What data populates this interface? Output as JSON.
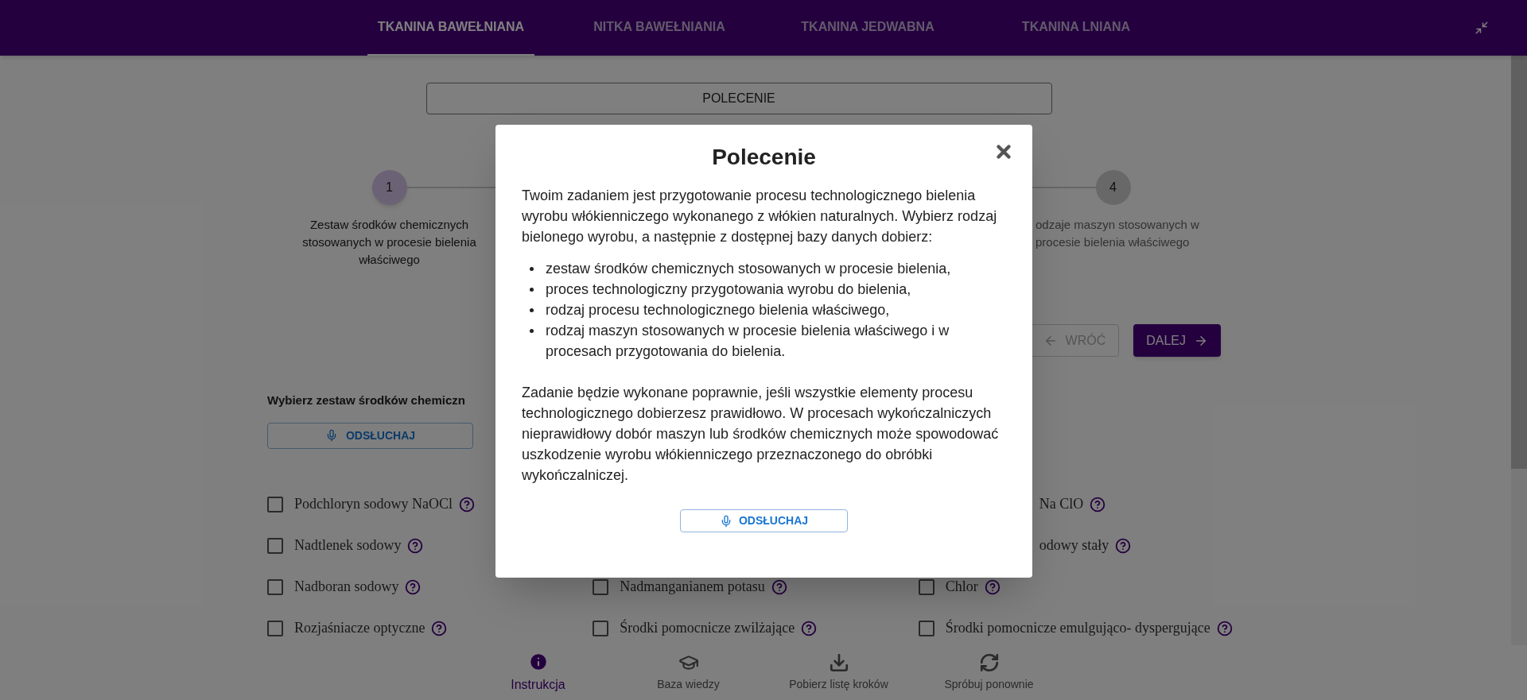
{
  "tabs": [
    {
      "label": "TKANINA BAWEŁNIANA",
      "selected": true
    },
    {
      "label": "NITKA BAWEŁNIANIA",
      "selected": false
    },
    {
      "label": "TKANINA JEDWABNA",
      "selected": false
    },
    {
      "label": "TKANINA LNIANA",
      "selected": false
    }
  ],
  "command_button": "POLECENIE",
  "steps": [
    {
      "number": "1",
      "label": "Zestaw środków chemicznych stosowanych w procesie bielenia właściwego",
      "active": true
    },
    {
      "number": "4",
      "label": "odzaje maszyn stosowanych w procesie bielenia właściwego",
      "active": false
    }
  ],
  "nav_buttons": [
    {
      "label": "WRÓĆ",
      "disabled": true,
      "kind": "back"
    },
    {
      "label": "DALEJ",
      "disabled": false,
      "kind": "next"
    }
  ],
  "section": {
    "heading": "Wybierz zestaw środków chemiczn",
    "listen_button": "ODSŁUCHAJ"
  },
  "option_rows": [
    {
      "col_1": {
        "label": "Podchloryn sodowy NaOCl",
        "checked": false,
        "kind": "checkbox"
      },
      "col_3": {
        "label": "Na ClO",
        "kind": "clipped"
      }
    },
    {
      "col_1": {
        "label": "Nadtlenek sodowy",
        "checked": false,
        "kind": "checkbox"
      },
      "col_3": {
        "label": "odowy stały",
        "kind": "clipped"
      }
    },
    {
      "col_1": {
        "label": "Nadboran sodowy",
        "checked": false,
        "kind": "checkbox"
      },
      "col_2": {
        "label": "Nadmanganianem potasu",
        "checked": false,
        "kind": "checkbox"
      },
      "col_3": {
        "label": "Chlor",
        "checked": false,
        "kind": "checkbox"
      }
    },
    {
      "col_1": {
        "label": "Rozjaśniacze optyczne",
        "checked": false,
        "kind": "checkbox"
      },
      "col_2": {
        "label": "Środki pomocnicze zwilżające",
        "checked": false,
        "kind": "checkbox"
      },
      "col_3": {
        "label": "Środki pomocnicze emulgująco- dyspergujące",
        "checked": false,
        "kind": "checkbox"
      }
    }
  ],
  "modal": {
    "title": "Polecenie",
    "intro": "Twoim zadaniem jest przygotowanie procesu technologicznego bielenia wyrobu włókienniczego wykonanego z włókien naturalnych. Wybierz rodzaj bielonego wyrobu, a następnie z dostępnej bazy danych dobierz:",
    "bullets": [
      "zestaw środków chemicznych stosowanych w procesie bielenia,",
      "proces technologiczny przygotowania wyrobu do bielenia,",
      "rodzaj procesu technologicznego bielenia właściwego,",
      "rodzaj maszyn stosowanych w procesie bielenia właściwego i w procesach przygotowania do bielenia."
    ],
    "closing": "Zadanie będzie wykonane poprawnie, jeśli wszystkie elementy procesu technologicznego dobierzesz prawidłowo. W procesach wykończalniczych nieprawidłowy dobór maszyn lub środków chemicznych może spowodować uszkodzenie wyrobu włókienniczego przeznaczonego do obróbki wykończalniczej.",
    "listen_button": "ODSŁUCHAJ"
  },
  "bottom_nav": [
    {
      "label": "Instrukcja",
      "selected": true,
      "kind": "info"
    },
    {
      "label": "Baza wiedzy",
      "selected": false,
      "kind": "knowledge"
    },
    {
      "label": "Pobierz listę kroków",
      "selected": false,
      "kind": "download"
    },
    {
      "label": "Spróbuj ponownie",
      "selected": false,
      "kind": "retry"
    }
  ]
}
